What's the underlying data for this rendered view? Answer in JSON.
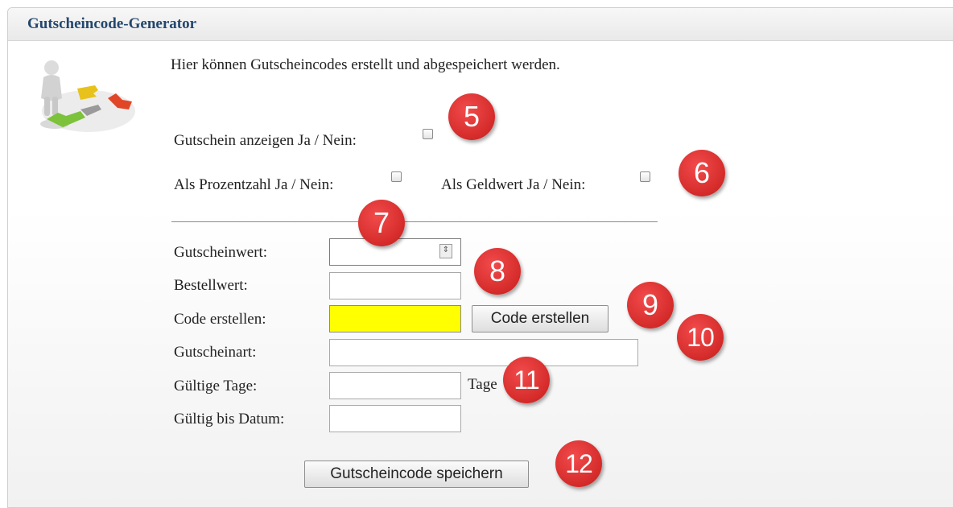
{
  "header": {
    "title": "Gutscheincode-Generator"
  },
  "intro": {
    "text": "Hier können Gutscheincodes erstellt und abgespeichert werden."
  },
  "options": {
    "show_voucher_label": "Gutschein anzeigen Ja / Nein:",
    "as_percent_label": "Als Prozentzahl Ja / Nein:",
    "as_money_label": "Als Geldwert Ja / Nein:"
  },
  "form": {
    "voucher_value_label": "Gutscheinwert:",
    "voucher_value": "",
    "order_value_label": "Bestellwert:",
    "order_value": "",
    "code_label": "Code erstellen:",
    "code_value": "",
    "create_code_button": "Code erstellen",
    "voucher_type_label": "Gutscheinart:",
    "voucher_type_value": "",
    "valid_days_label": "Gültige Tage:",
    "valid_days_value": "",
    "days_unit": "Tage",
    "valid_until_label": "Gültig bis Datum:",
    "valid_until_value": "",
    "save_button": "Gutscheincode speichern"
  },
  "annotations": [
    "5",
    "6",
    "7",
    "8",
    "9",
    "10",
    "11",
    "12"
  ],
  "colors": {
    "header_title": "#24476e",
    "code_field_bg": "#ffff00",
    "badge": "#d42a2a"
  }
}
